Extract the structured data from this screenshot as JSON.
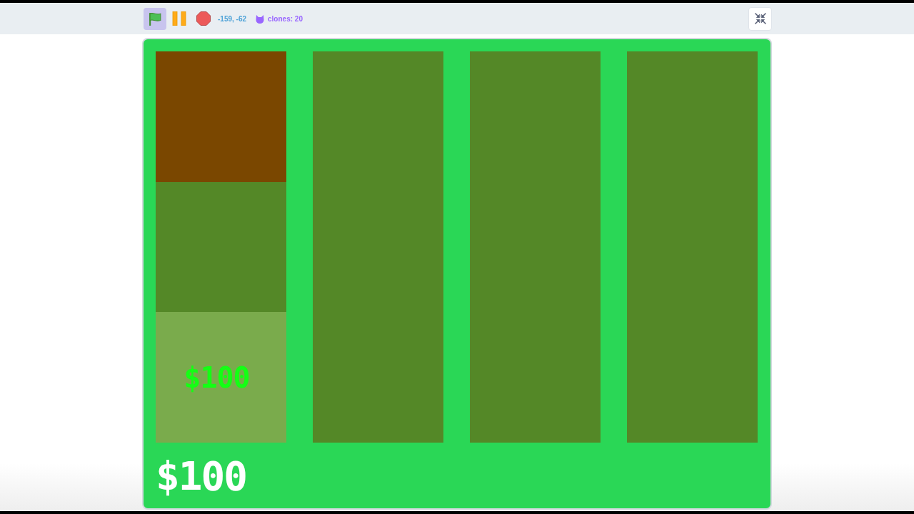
{
  "toolbar": {
    "controls": [
      {
        "kind": "flag",
        "active": true
      },
      {
        "kind": "pause",
        "active": false
      },
      {
        "kind": "stop",
        "active": false
      }
    ],
    "mouse_position": "-159, -62",
    "clone_count": "clones: 20"
  },
  "stage": {
    "columns": [
      {
        "cells": [
          {
            "color": "#7a4700"
          },
          {
            "color": "#548827"
          },
          {
            "color": "#7aab4c",
            "label": "$100"
          }
        ]
      },
      {
        "cells": [
          {
            "color": "#548827"
          }
        ]
      },
      {
        "cells": [
          {
            "color": "#548827"
          }
        ]
      },
      {
        "cells": [
          {
            "color": "#548827"
          }
        ]
      }
    ],
    "score": "$100"
  }
}
